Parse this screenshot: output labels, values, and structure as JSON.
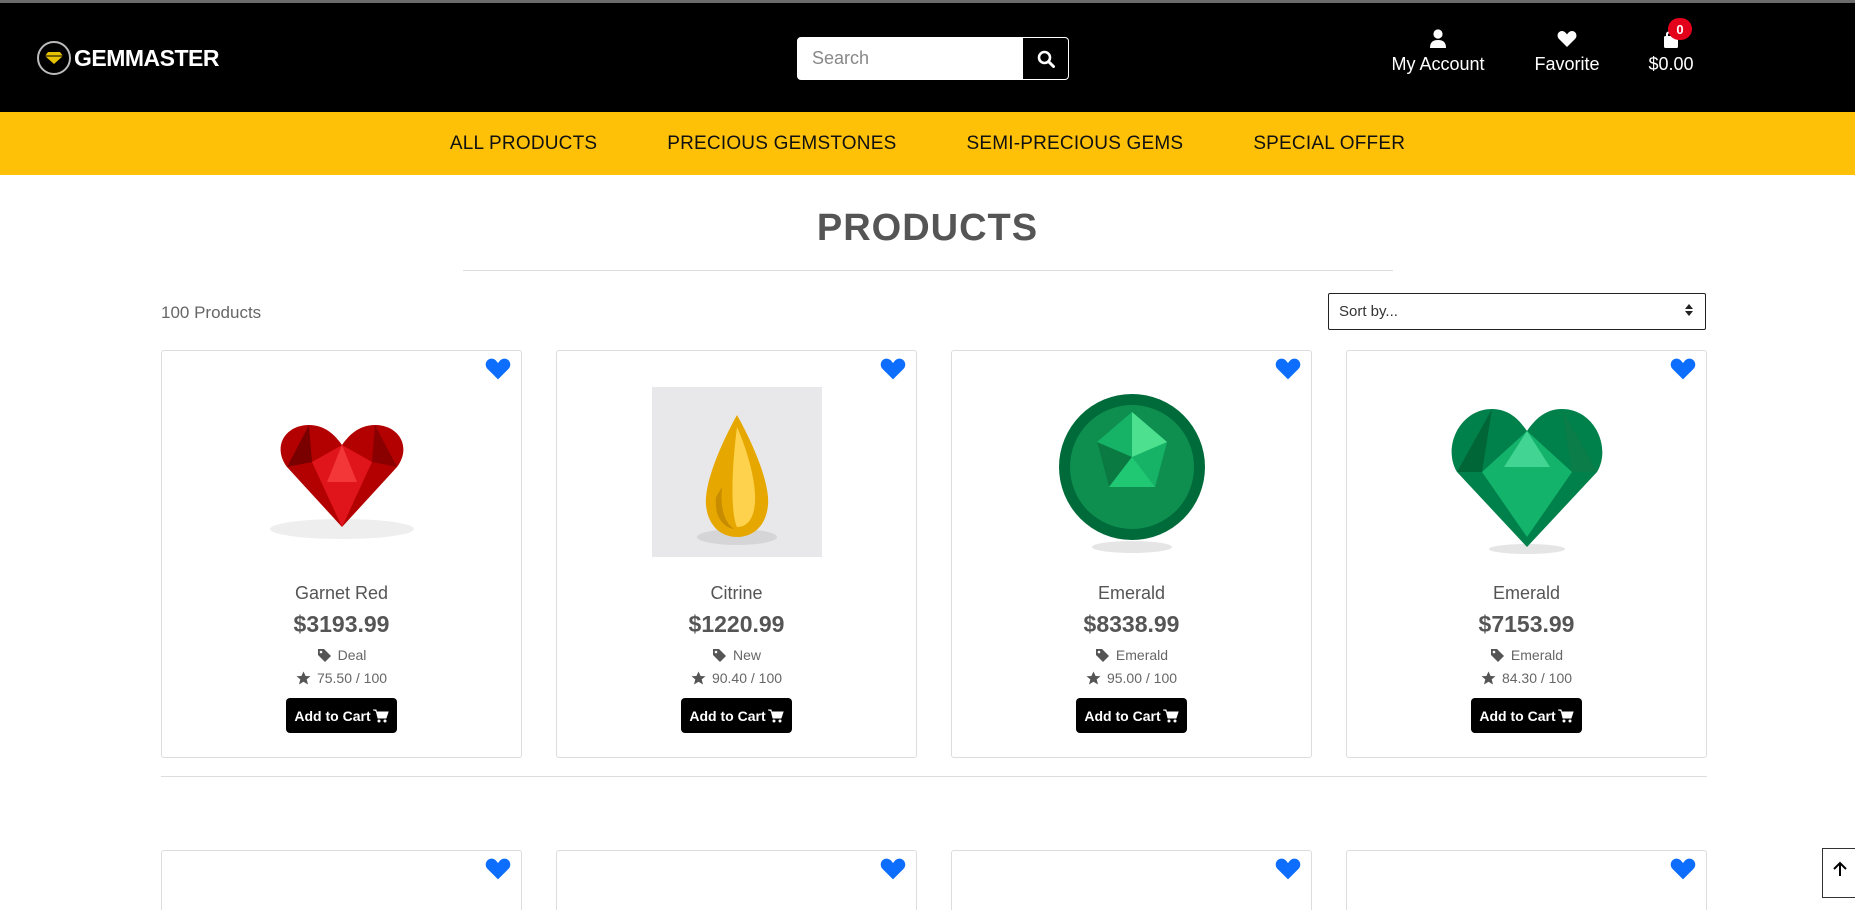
{
  "header": {
    "brand": "GEMMASTER",
    "search_placeholder": "Search",
    "account_label": "My Account",
    "favorite_label": "Favorite",
    "cart_total": "$0.00",
    "cart_count": "0"
  },
  "nav": {
    "items": [
      {
        "label": "ALL PRODUCTS"
      },
      {
        "label": "PRECIOUS GEMSTONES"
      },
      {
        "label": "SEMI-PRECIOUS GEMS"
      },
      {
        "label": "SPECIAL OFFER"
      }
    ]
  },
  "page": {
    "title": "PRODUCTS",
    "product_count": "100 Products",
    "sort_label": "Sort by..."
  },
  "products": [
    {
      "name": "Garnet Red",
      "price": "$3193.99",
      "tag": "Deal",
      "rating": "75.50 / 100",
      "cta": "Add to Cart"
    },
    {
      "name": "Citrine",
      "price": "$1220.99",
      "tag": "New",
      "rating": "90.40 / 100",
      "cta": "Add to Cart"
    },
    {
      "name": "Emerald",
      "price": "$8338.99",
      "tag": "Emerald",
      "rating": "95.00 / 100",
      "cta": "Add to Cart"
    },
    {
      "name": "Emerald",
      "price": "$7153.99",
      "tag": "Emerald",
      "rating": "84.30 / 100",
      "cta": "Add to Cart"
    }
  ],
  "colors": {
    "nav_bar": "#ffc107",
    "header_bg": "#000000",
    "favorite_heart": "#0d6efd",
    "cart_badge": "#e3001b"
  },
  "icons": [
    "user-icon",
    "heart-icon",
    "shopping-bag-icon",
    "search-icon",
    "tag-icon",
    "star-icon",
    "cart-icon",
    "arrow-up-icon"
  ]
}
